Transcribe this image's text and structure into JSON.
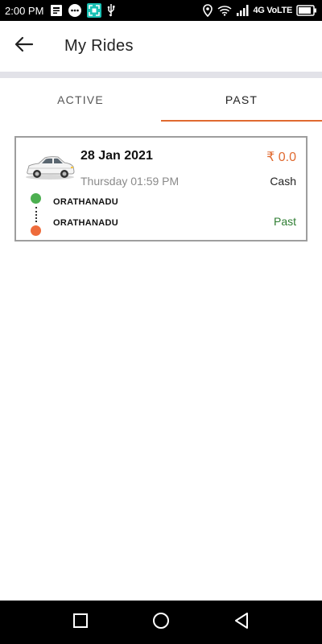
{
  "status_bar": {
    "time": "2:00 PM",
    "network": "4G VoLTE",
    "icons": [
      "document-icon",
      "chat-icon",
      "scan-icon",
      "usb-icon",
      "location-icon",
      "wifi-icon",
      "signal-icon",
      "battery-icon"
    ]
  },
  "app_bar": {
    "back_icon": "arrow-left-icon",
    "title": "My Rides"
  },
  "tabs": [
    {
      "label": "ACTIVE",
      "selected": false
    },
    {
      "label": "PAST",
      "selected": true
    }
  ],
  "rides": [
    {
      "date": "28 Jan 2021",
      "time": "Thursday 01:59 PM",
      "fare": "₹ 0.0",
      "payment": "Cash",
      "pickup": "ORATHANADU",
      "drop": "ORATHANADU",
      "status": "Past"
    }
  ],
  "nav_bar": {
    "buttons": [
      "recents-square-icon",
      "home-circle-icon",
      "back-triangle-icon"
    ]
  },
  "colors": {
    "accent": "#e06a30",
    "pickup": "#4caf50",
    "drop": "#ee6b3b",
    "status_past": "#2e7d32"
  }
}
